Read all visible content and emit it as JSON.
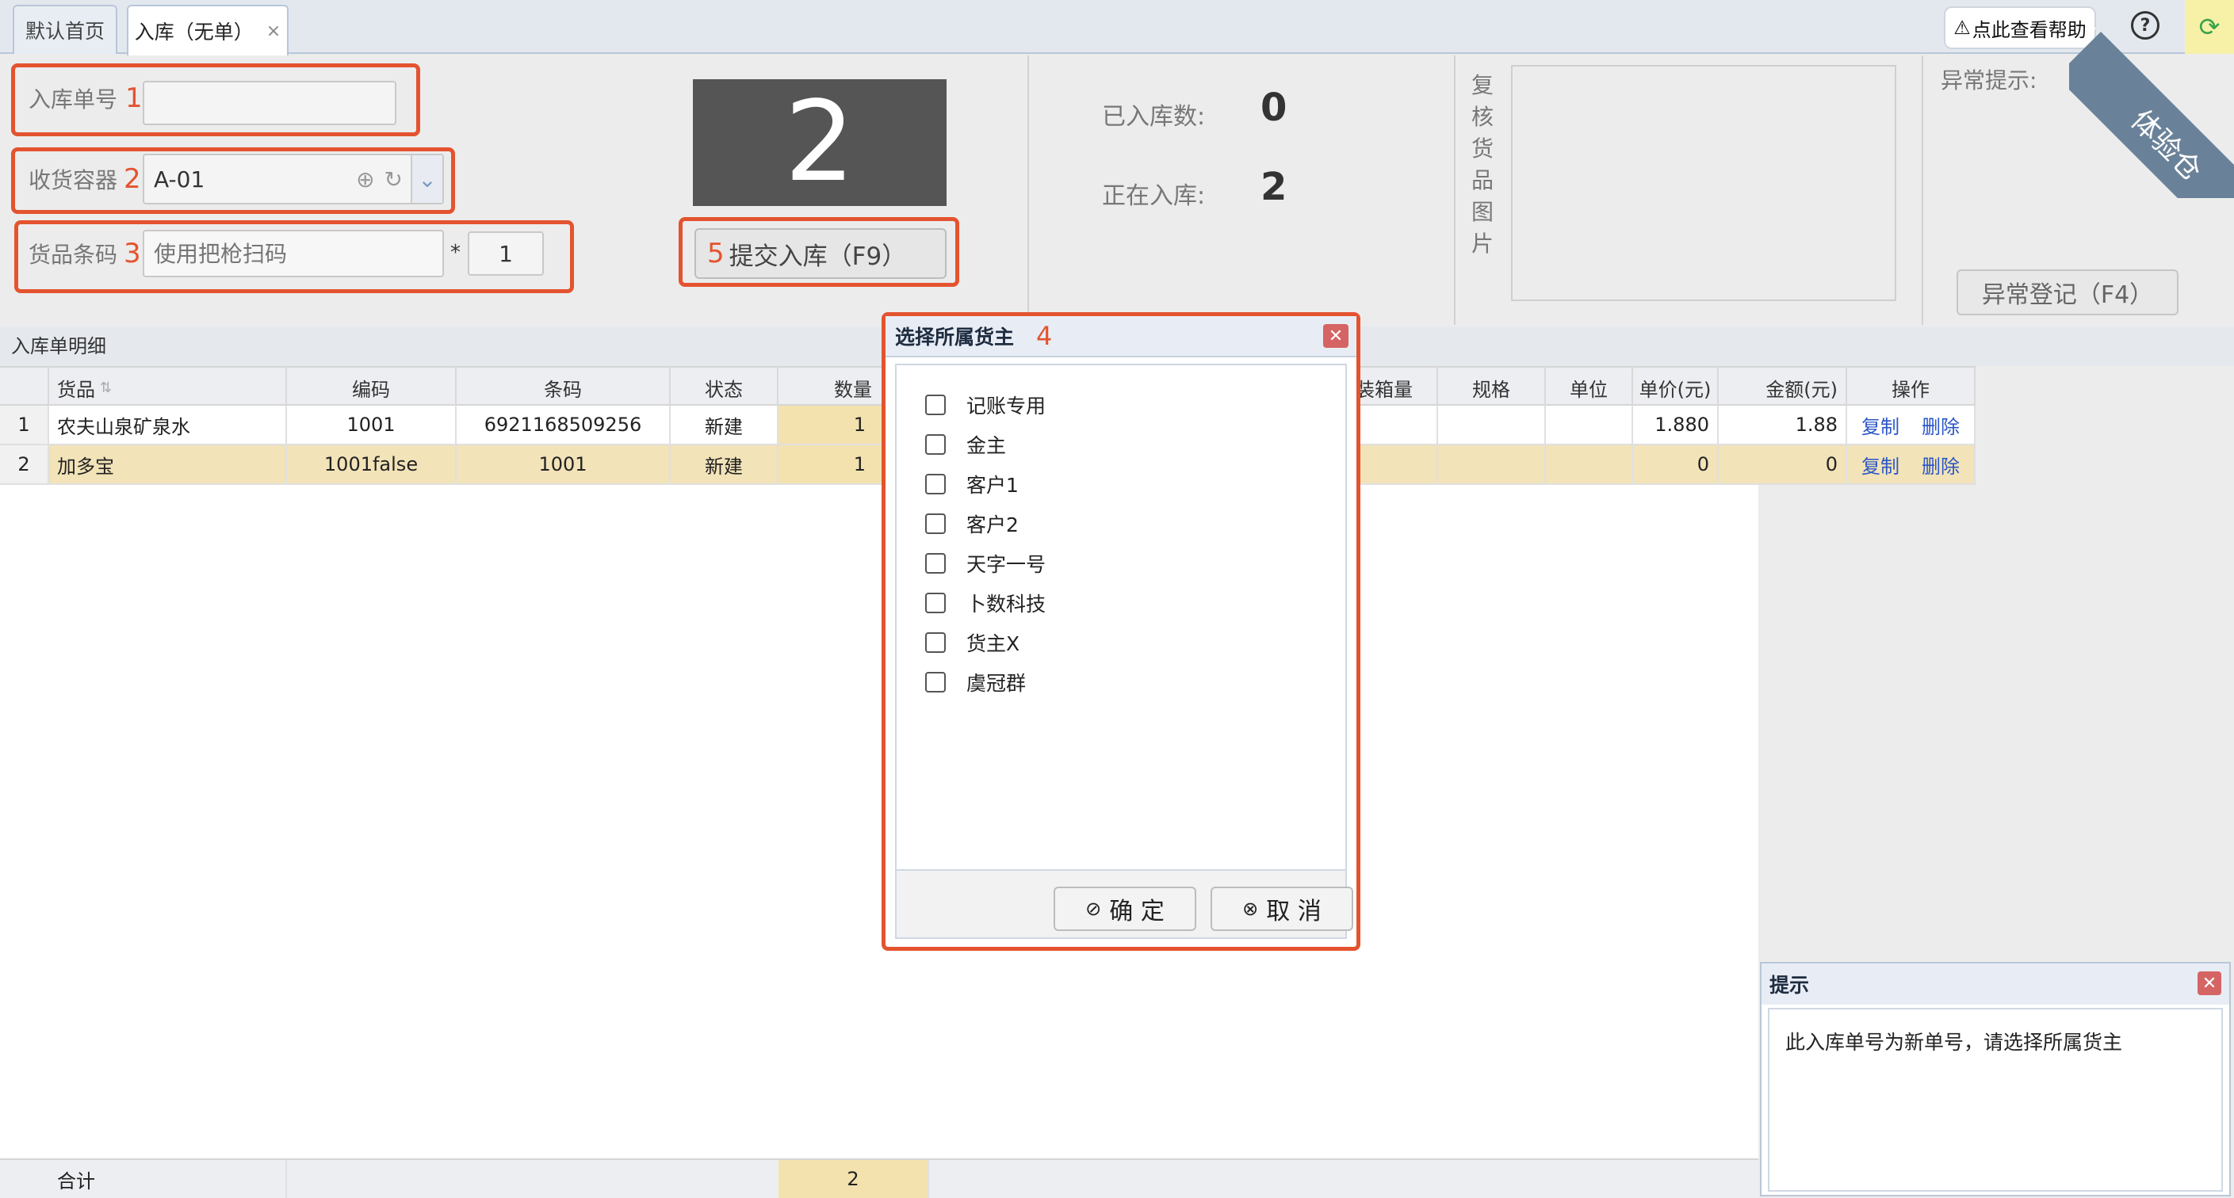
{
  "tabs": [
    {
      "label": "默认首页"
    },
    {
      "label": "入库（无单）",
      "close": "×"
    }
  ],
  "header": {
    "help_label": "点此查看帮助",
    "help_icon": "warning-icon",
    "question": "?",
    "refresh": "⟳"
  },
  "form": {
    "order_no": {
      "label": "入库单号",
      "marker": "1",
      "value": ""
    },
    "container": {
      "label": "收货容器",
      "marker": "2",
      "value": "A-01",
      "add_icon": "⊕",
      "reload_icon": "↻",
      "dropdown_icon": "⌄"
    },
    "barcode": {
      "label": "货品条码",
      "marker": "3",
      "placeholder": "使用把枪扫码",
      "multiply": "*",
      "qty": "1"
    },
    "big_count": "2",
    "submit": {
      "marker": "5",
      "label": "提交入库（F9）"
    }
  },
  "stats": {
    "received_label": "已入库数:",
    "received_value": "0",
    "in_progress_label": "正在入库:",
    "in_progress_value": "2"
  },
  "review": {
    "label": "复核货品图片"
  },
  "abnormal": {
    "label": "异常提示:",
    "button": "异常登记（F4）",
    "corner": "体验仓"
  },
  "grid": {
    "title": "入库单明细",
    "columns": [
      "货品",
      "编码",
      "条码",
      "状态",
      "数量",
      "装箱量",
      "规格",
      "单位",
      "单价(元)",
      "金额(元)",
      "操作"
    ],
    "rows": [
      {
        "idx": "1",
        "name": "农夫山泉矿泉水",
        "code": "1001",
        "barcode": "6921168509256",
        "status": "新建",
        "qty": "1",
        "price": "1.880",
        "amount": "1.88",
        "copy": "复制",
        "delete": "删除"
      },
      {
        "idx": "2",
        "name": "加多宝",
        "code": "1001false",
        "barcode": "1001",
        "status": "新建",
        "qty": "1",
        "price": "0",
        "amount": "0",
        "copy": "复制",
        "delete": "删除"
      }
    ],
    "footer": {
      "label": "合计",
      "qty_total": "2"
    }
  },
  "modal": {
    "title": "选择所属货主",
    "marker": "4",
    "close": "✕",
    "options": [
      "记账专用",
      "金主",
      "客户1",
      "客户2",
      "天字一号",
      "卜数科技",
      "货主X",
      "虞冠群"
    ],
    "ok": "确 定",
    "cancel": "取 消"
  },
  "tip": {
    "title": "提示",
    "close": "✕",
    "message": "此入库单号为新单号，请选择所属货主"
  },
  "colors": {
    "accent_red": "#e4532f",
    "link": "#2a56c6",
    "selected_row": "#f2e3b8"
  }
}
